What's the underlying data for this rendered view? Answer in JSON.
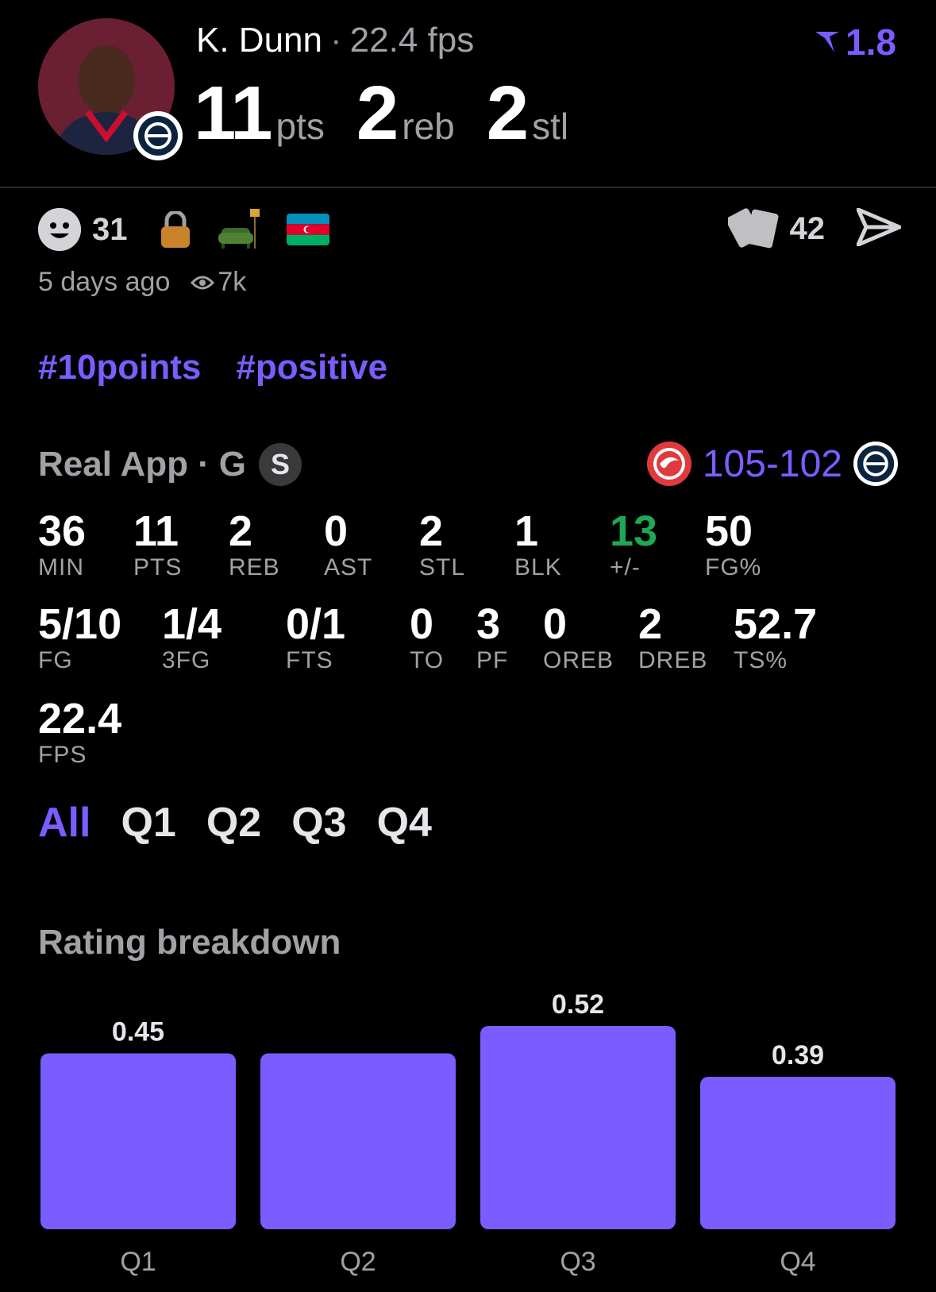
{
  "player": {
    "name": "K. Dunn",
    "fps": "22.4 fps",
    "headline": [
      {
        "value": "11",
        "unit": "pts"
      },
      {
        "value": "2",
        "unit": "reb"
      },
      {
        "value": "2",
        "unit": "stl"
      }
    ],
    "rating": "1.8"
  },
  "social": {
    "reactions": "31",
    "cards": "42",
    "posted": "5 days ago",
    "views": "7k"
  },
  "tags": [
    "#10points",
    "#positive"
  ],
  "game": {
    "source": "Real App",
    "position": "G",
    "badge": "S",
    "score_home": "105",
    "score_sep": "-",
    "score_away": "102"
  },
  "stats_row1": [
    {
      "value": "36",
      "label": "MIN"
    },
    {
      "value": "11",
      "label": "PTS"
    },
    {
      "value": "2",
      "label": "REB"
    },
    {
      "value": "0",
      "label": "AST"
    },
    {
      "value": "2",
      "label": "STL"
    },
    {
      "value": "1",
      "label": "BLK"
    },
    {
      "value": "13",
      "label": "+/-",
      "highlight": "#1fa855"
    },
    {
      "value": "50",
      "label": "FG%"
    }
  ],
  "stats_row2": [
    {
      "value": "5/10",
      "label": "FG"
    },
    {
      "value": "1/4",
      "label": "3FG"
    },
    {
      "value": "0/1",
      "label": "FTS"
    },
    {
      "value": "0",
      "label": "TO"
    },
    {
      "value": "3",
      "label": "PF"
    },
    {
      "value": "0",
      "label": "OREB"
    },
    {
      "value": "2",
      "label": "DREB"
    },
    {
      "value": "52.7",
      "label": "TS%"
    }
  ],
  "stats_row3": [
    {
      "value": "22.4",
      "label": "FPS"
    }
  ],
  "tabs": [
    {
      "label": "All",
      "active": true
    },
    {
      "label": "Q1",
      "active": false
    },
    {
      "label": "Q2",
      "active": false
    },
    {
      "label": "Q3",
      "active": false
    },
    {
      "label": "Q4",
      "active": false
    }
  ],
  "rating_breakdown_title": "Rating breakdown",
  "colors": {
    "accent": "#7b5cff",
    "positive": "#1fa855"
  },
  "chart_data": {
    "type": "bar",
    "categories": [
      "Q1",
      "Q2",
      "Q3",
      "Q4"
    ],
    "values": [
      0.45,
      0.45,
      0.52,
      0.39
    ],
    "labels": [
      "0.45",
      "",
      "0.52",
      "0.39"
    ],
    "ylim": [
      0,
      0.52
    ]
  }
}
